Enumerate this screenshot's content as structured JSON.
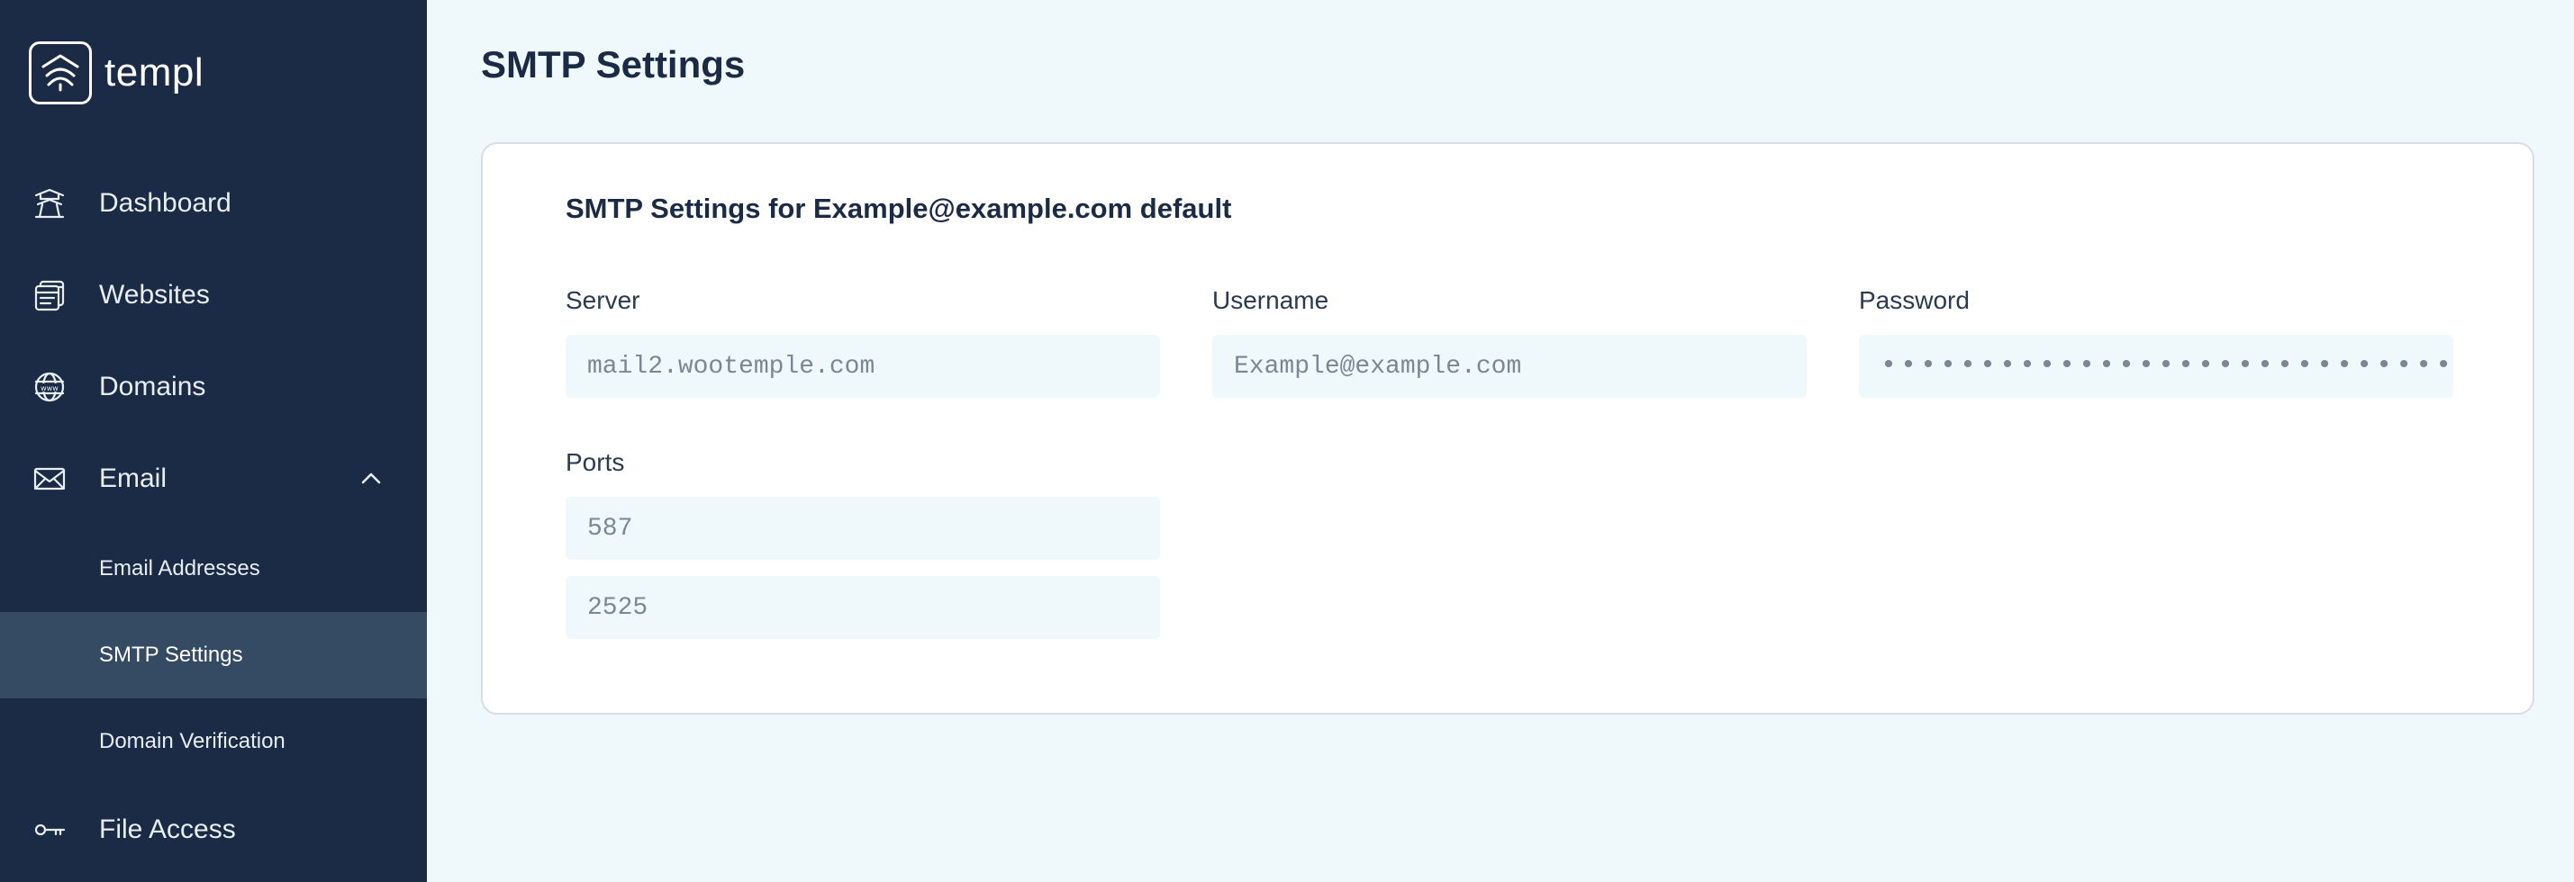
{
  "brand": {
    "name": "templ"
  },
  "sidebar": {
    "items": [
      {
        "label": "Dashboard",
        "icon": "pagoda-icon"
      },
      {
        "label": "Websites",
        "icon": "websites-icon"
      },
      {
        "label": "Domains",
        "icon": "globe-www-icon"
      },
      {
        "label": "Email",
        "icon": "envelope-icon",
        "expanded": true
      },
      {
        "label": "File Access",
        "icon": "key-icon"
      }
    ],
    "email_subitems": [
      {
        "label": "Email Addresses"
      },
      {
        "label": "SMTP Settings",
        "active": true
      },
      {
        "label": "Domain Verification"
      }
    ]
  },
  "page": {
    "title": "SMTP Settings"
  },
  "card": {
    "title": "SMTP Settings for Example@example.com default",
    "server": {
      "label": "Server",
      "value": "mail2.wootemple.com"
    },
    "username": {
      "label": "Username",
      "value": "Example@example.com"
    },
    "password": {
      "label": "Password",
      "value": "•••••••••••••••••••••••••••••"
    },
    "ports": {
      "label": "Ports",
      "values": [
        "587",
        "2525"
      ]
    }
  },
  "colors": {
    "sidebar_bg": "#1b2b45",
    "sidebar_active": "#354a63",
    "page_bg": "#eff9fb",
    "input_bg": "#eff9fb"
  }
}
